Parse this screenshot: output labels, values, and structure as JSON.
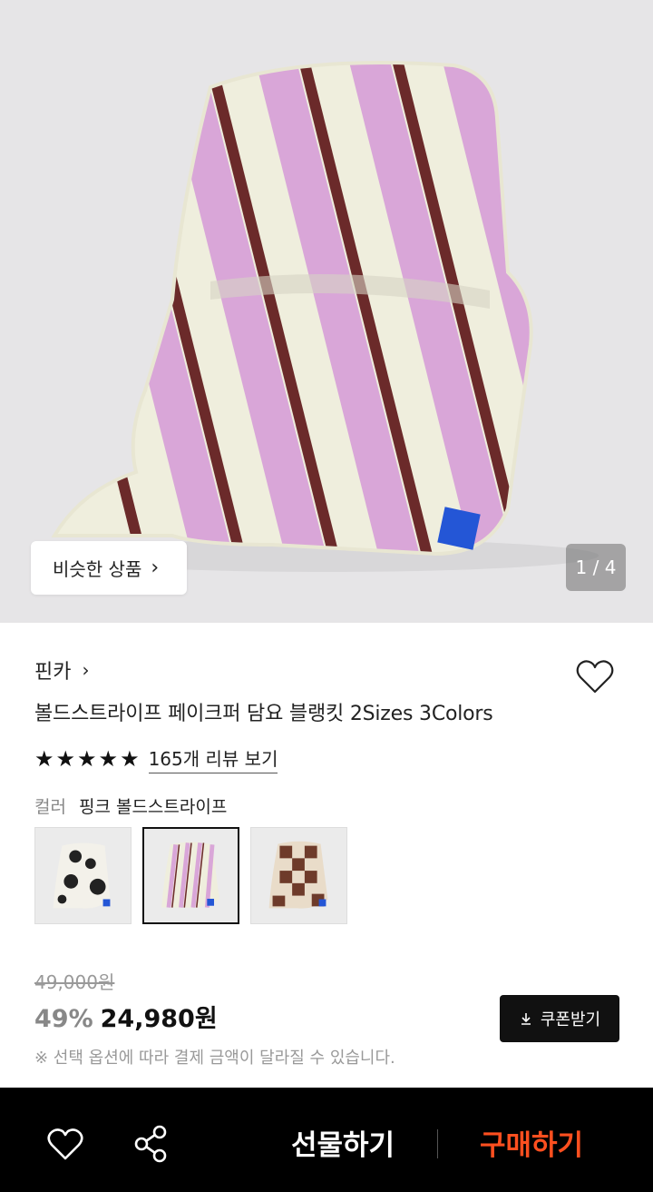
{
  "hero": {
    "similar_label": "비슷한 상품",
    "pager": "1 / 4"
  },
  "product": {
    "brand": "핀카",
    "title": "볼드스트라이프 페이크퍼 담요 블랭킷 2Sizes 3Colors",
    "rating": 5,
    "review_link": "165개 리뷰 보기",
    "option_key": "컬러",
    "option_value": "핑크 볼드스트라이프",
    "thumbnails": [
      {
        "name": "cow-pattern"
      },
      {
        "name": "pink-bold-stripe",
        "selected": true
      },
      {
        "name": "brown-checker"
      }
    ]
  },
  "price": {
    "original": "49,000원",
    "discount": "49%",
    "sale": "24,980원",
    "coupon_label": "쿠폰받기",
    "note": "※ 선택 옵션에 따라 결제 금액이 달라질 수 있습니다."
  },
  "bottom_bar": {
    "gift_label": "선물하기",
    "buy_label": "구매하기"
  },
  "colors": {
    "buy_accent": "#ff4f1f",
    "stripe_pink": "#d9a6d8",
    "stripe_brown": "#6b2a2a",
    "blanket_cream": "#efeedd"
  }
}
